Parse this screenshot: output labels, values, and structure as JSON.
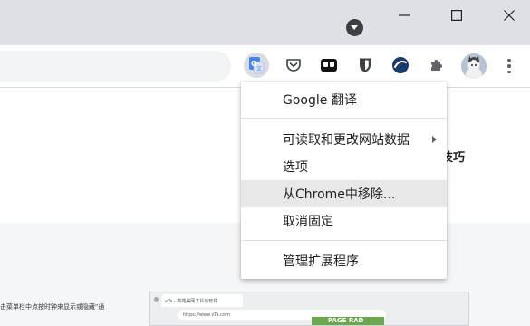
{
  "window": {
    "minimize_icon": "minimize-icon",
    "maximize_icon": "maximize-icon",
    "close_icon": "close-icon"
  },
  "toolbar": {
    "extensions": [
      {
        "name": "google-translate-icon",
        "active": true
      },
      {
        "name": "pocket-icon"
      },
      {
        "name": "tabbed-icon"
      },
      {
        "name": "bitwarden-icon"
      },
      {
        "name": "edge-sync-icon"
      },
      {
        "name": "extensions-puzzle-icon"
      }
    ]
  },
  "menu": {
    "title": "Google 翻译",
    "read_change_site_data": "可读取和更改网站数据",
    "options": "选项",
    "remove_from_chrome": "从Chrome中移除...",
    "unpin": "取消固定",
    "manage_extensions": "管理扩展程序"
  },
  "page": {
    "heading_fragment": "技巧",
    "snippet": "击菜单栏中点按时钟来显示或隐藏\"通",
    "thumbnail": {
      "tab_label": "vTa - 高端美网工具与软件",
      "url": "https://www.vTa.com",
      "badge": "PAGE RAD"
    }
  },
  "colors": {
    "titlebar": "#dee1e6",
    "menu_hover": "#e8e8e9",
    "accent_blue": "#4285f4"
  }
}
